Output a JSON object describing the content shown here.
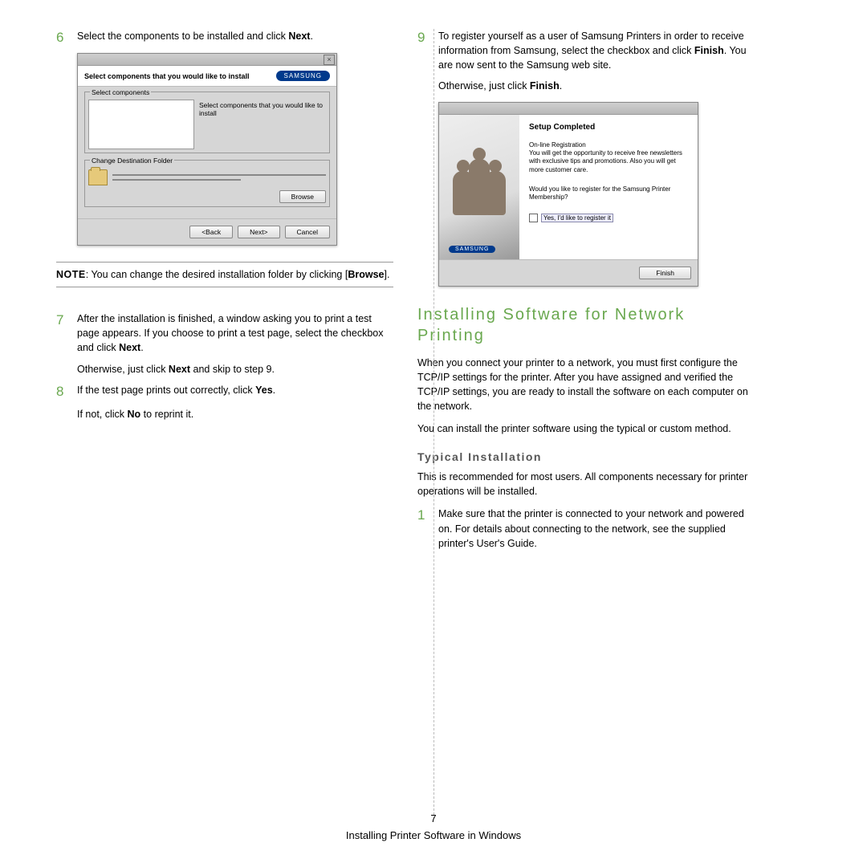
{
  "left": {
    "step6": {
      "num": "6",
      "text_a": "Select the components to be installed and click ",
      "text_b": "Next",
      "text_c": "."
    },
    "dlg1": {
      "header": "Select components that you would like to install",
      "brand": "SAMSUNG",
      "fs1_label": "Select components",
      "fs1_right": "Select components that you would like to install",
      "fs2_label": "Change Destination Folder",
      "browse": "Browse",
      "back": "<Back",
      "next": "Next>",
      "cancel": "Cancel"
    },
    "note": {
      "label": "NOTE",
      "text_a": ": You can change the desired installation folder by clicking [",
      "text_b": "Browse",
      "text_c": "]."
    },
    "step7": {
      "num": "7",
      "text_a": "After the installation is finished, a window asking you to print a test page appears. If you choose to print a test page, select the checkbox and click ",
      "text_b": "Next",
      "text_c": ".",
      "sub_a": "Otherwise, just click ",
      "sub_b": "Next",
      "sub_c": " and skip to step 9."
    },
    "step8": {
      "num": "8",
      "text_a": "If the test page prints out correctly, click ",
      "text_b": "Yes",
      "text_c": ".",
      "sub_a": "If not, click ",
      "sub_b": "No",
      "sub_c": " to reprint it."
    }
  },
  "right": {
    "step9": {
      "num": "9",
      "text_a": "To register yourself as a user of Samsung Printers in order to receive information from Samsung, select the checkbox and click ",
      "text_b": "Finish",
      "text_c": ". You are now sent to the Samsung web site.",
      "sub_a": "Otherwise, just click ",
      "sub_b": "Finish",
      "sub_c": "."
    },
    "dlg2": {
      "title": "Setup Completed",
      "reg_head": "On-line Registration",
      "reg_body": "You will get the opportunity to receive free newsletters with exclusive tips and promotions. Also you will get more customer care.",
      "question": "Would you like to register for the Samsung Printer Membership?",
      "checkbox": "Yes, I'd like to register it",
      "brand": "SAMSUNG",
      "finish": "Finish"
    },
    "h2": "Installing Software for Network Printing",
    "p1": "When you connect your printer to a network, you must first configure the TCP/IP settings for the printer. After you have assigned and verified the TCP/IP settings, you are ready to install the software on each computer on the network.",
    "p2": "You can install the printer software using the typical or custom method.",
    "h3": "Typical Installation",
    "p3": "This is recommended for most users. All components necessary for printer operations will be installed.",
    "step1": {
      "num": "1",
      "text": "Make sure that the printer is connected to your network and powered on. For details about connecting to the network, see the supplied printer's User's Guide."
    }
  },
  "footer": {
    "page": "7",
    "title": "Installing Printer Software in Windows"
  }
}
